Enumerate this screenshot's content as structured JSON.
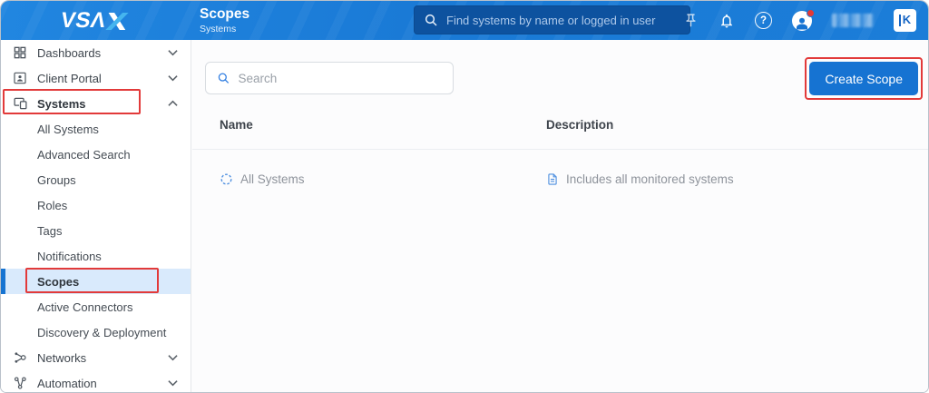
{
  "header": {
    "logo_text": "VSΛ",
    "page_title": "Scopes",
    "page_subtitle": "Systems",
    "search_placeholder": "Find systems by name or logged in user",
    "kaseya_badge": "K"
  },
  "sidebar": {
    "items": [
      {
        "label": "Dashboards",
        "type": "parent",
        "chevron": "down"
      },
      {
        "label": "Client Portal",
        "type": "parent",
        "chevron": "down"
      },
      {
        "label": "Systems",
        "type": "parent",
        "chevron": "up",
        "annotated": true,
        "expanded": true
      },
      {
        "label": "All Systems",
        "type": "child"
      },
      {
        "label": "Advanced Search",
        "type": "child"
      },
      {
        "label": "Groups",
        "type": "child"
      },
      {
        "label": "Roles",
        "type": "child"
      },
      {
        "label": "Tags",
        "type": "child"
      },
      {
        "label": "Notifications",
        "type": "child"
      },
      {
        "label": "Scopes",
        "type": "child",
        "selected": true,
        "annotated": true
      },
      {
        "label": "Active Connectors",
        "type": "child"
      },
      {
        "label": "Discovery & Deployment",
        "type": "child"
      },
      {
        "label": "Networks",
        "type": "parent",
        "chevron": "down"
      },
      {
        "label": "Automation",
        "type": "parent",
        "chevron": "down"
      }
    ]
  },
  "main": {
    "search_placeholder": "Search",
    "create_scope_label": "Create Scope",
    "table": {
      "columns": [
        "Name",
        "Description"
      ],
      "rows": [
        {
          "name": "All Systems",
          "description": "Includes all monitored systems"
        }
      ]
    }
  },
  "colors": {
    "header_blue": "#1b7dd8",
    "header_search_bg": "#0d529f",
    "accent_blue": "#1673d2",
    "selected_row_bg": "#d9eafc",
    "annotation_red": "#e23a3a",
    "logo_accent_cyan": "#45b5ef"
  }
}
